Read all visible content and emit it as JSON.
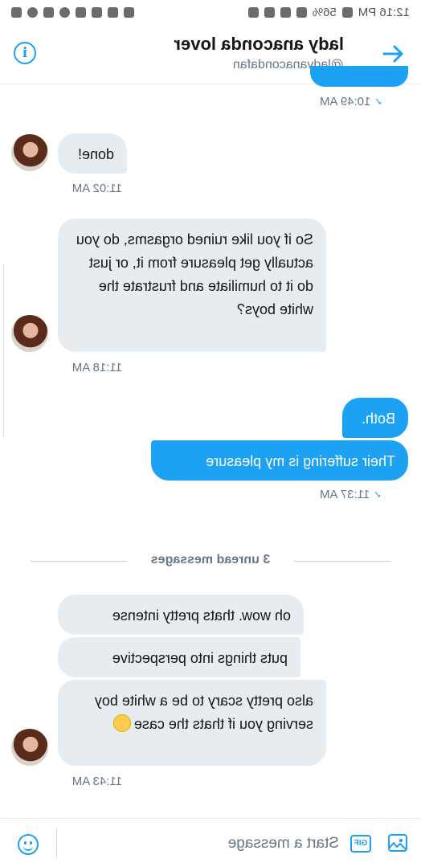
{
  "status_bar": {
    "time": "12:16 PM",
    "battery": "56%"
  },
  "header": {
    "title": "lady anaconda lover",
    "handle": "@ladyanacondafan",
    "back_icon": "arrow-icon",
    "info_icon": "i"
  },
  "messages": [
    {
      "time": "10:49 AM"
    },
    {
      "text": "done!",
      "time": "11:02 AM"
    },
    {
      "text": "So if you like ruined orgasms, do you actually get pleasure from it, or just do it to humiliate and frustrate the white boys?",
      "time": "11:18 AM"
    },
    {
      "text": "Both."
    },
    {
      "text": "Their suffering is my pleasure",
      "time": "11:37 AM"
    },
    {
      "text": "oh wow. thats pretty intense"
    },
    {
      "text": "puts things into perspective"
    },
    {
      "text": "also pretty scary to be a white boy serving you if thats the case",
      "time": "11:43 AM"
    }
  ],
  "divider": {
    "label": "3 unread messages"
  },
  "composer": {
    "placeholder": "Start a message",
    "gif_label": "GIF"
  },
  "colors": {
    "accent": "#1da1f2",
    "received_bubble": "#e6ecf0"
  }
}
